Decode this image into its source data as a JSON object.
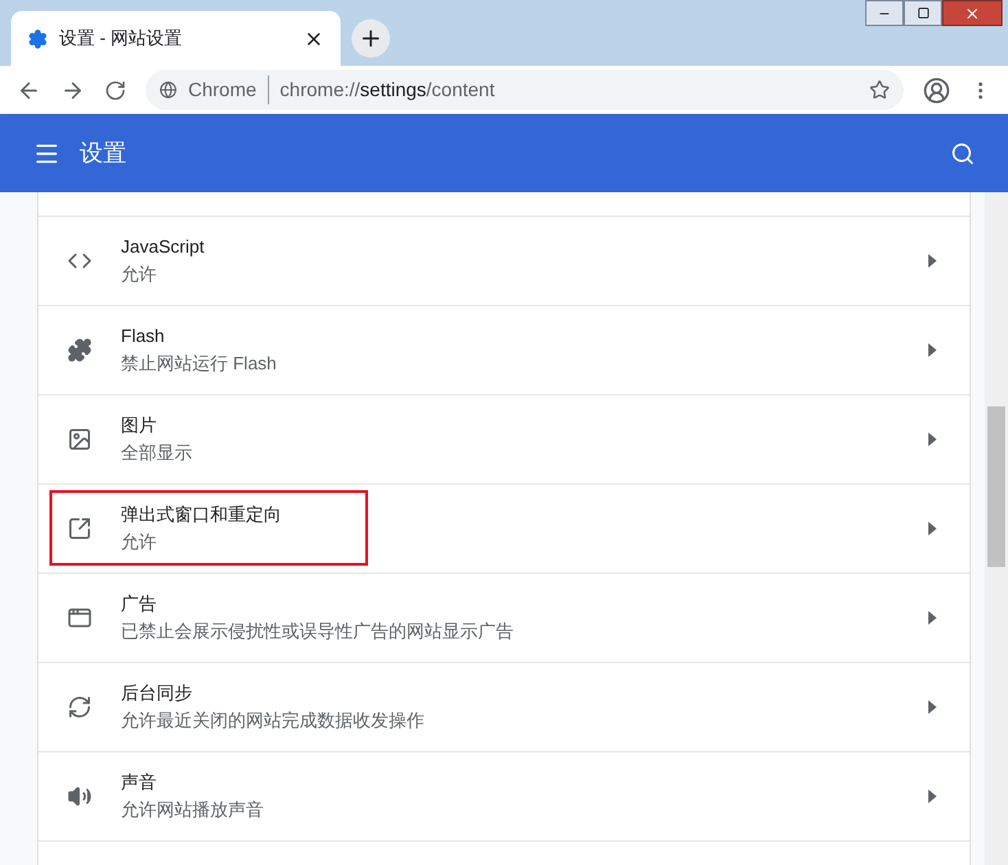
{
  "tab": {
    "title": "设置 - 网站设置"
  },
  "omnibox": {
    "site_label": "Chrome",
    "url_prefix": "chrome://",
    "url_host": "settings",
    "url_path": "/content"
  },
  "header": {
    "title": "设置"
  },
  "rows": [
    {
      "kind": "code",
      "title": "JavaScript",
      "subtitle": "允许",
      "highlighted": false
    },
    {
      "kind": "puzzle",
      "title": "Flash",
      "subtitle": "禁止网站运行 Flash",
      "highlighted": false
    },
    {
      "kind": "image",
      "title": "图片",
      "subtitle": "全部显示",
      "highlighted": false
    },
    {
      "kind": "external",
      "title": "弹出式窗口和重定向",
      "subtitle": "允许",
      "highlighted": true
    },
    {
      "kind": "window",
      "title": "广告",
      "subtitle": "已禁止会展示侵扰性或误导性广告的网站显示广告",
      "highlighted": false
    },
    {
      "kind": "sync",
      "title": "后台同步",
      "subtitle": "允许最近关闭的网站完成数据收发操作",
      "highlighted": false
    },
    {
      "kind": "volume",
      "title": "声音",
      "subtitle": "允许网站播放声音",
      "highlighted": false
    }
  ]
}
